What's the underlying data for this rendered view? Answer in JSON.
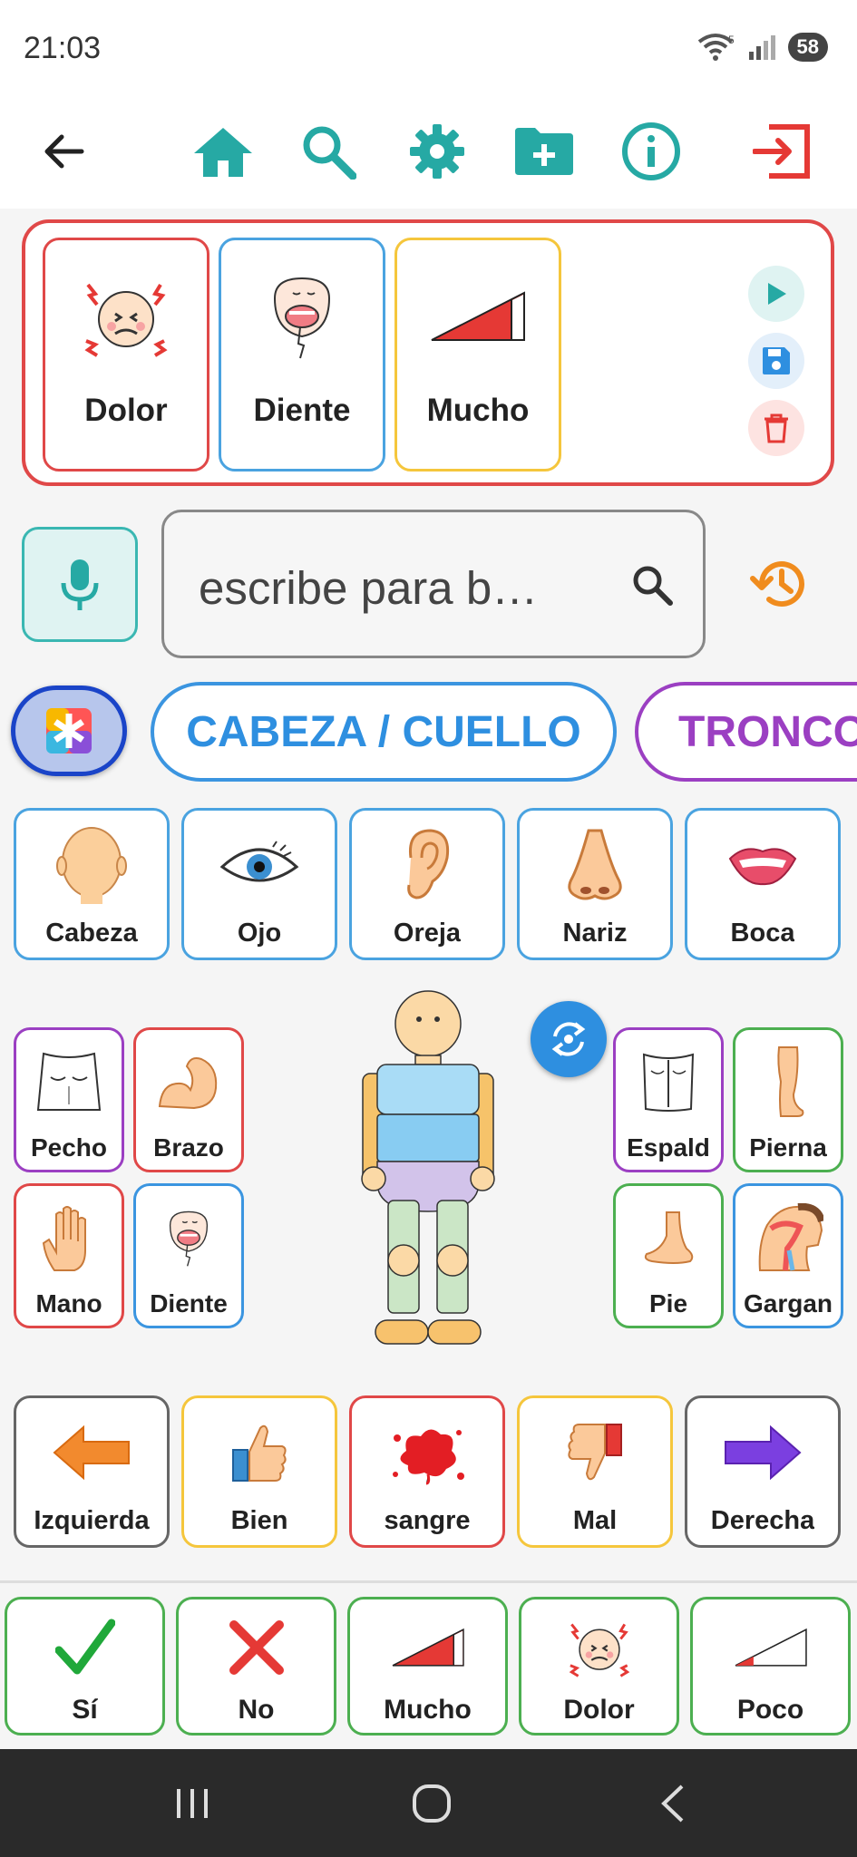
{
  "status": {
    "time": "21:03",
    "battery": "58",
    "wifi_badge": "5"
  },
  "toolbar": {
    "icons": [
      "back-arrow-icon",
      "home-icon",
      "search-icon",
      "settings-gear-icon",
      "folder-add-icon",
      "info-icon",
      "exit-icon"
    ],
    "accent": "#26a9a4",
    "exit_color": "#e53935"
  },
  "sentence": {
    "items": [
      {
        "label": "Dolor",
        "icon": "pain-face-icon",
        "border": "#e04848"
      },
      {
        "label": "Diente",
        "icon": "tooth-face-icon",
        "border": "#4aa3e0"
      },
      {
        "label": "Mucho",
        "icon": "much-ramp-icon",
        "border": "#f5c63c"
      }
    ],
    "actions": [
      "play-icon",
      "save-icon",
      "trash-icon"
    ]
  },
  "search": {
    "placeholder": "escribe para b…"
  },
  "categories": [
    {
      "label": "",
      "icon": "medical-star-icon",
      "border": "#1a44c8"
    },
    {
      "label": "CABEZA / CUELLO",
      "border": "#3b95e0",
      "color": "#2e8fe0"
    },
    {
      "label": "TRONCO",
      "border": "#9b3fc2",
      "color": "#9b3fc2"
    }
  ],
  "head_items": [
    {
      "label": "Cabeza",
      "icon": "head-icon"
    },
    {
      "label": "Ojo",
      "icon": "eye-icon"
    },
    {
      "label": "Oreja",
      "icon": "ear-icon"
    },
    {
      "label": "Nariz",
      "icon": "nose-icon"
    },
    {
      "label": "Boca",
      "icon": "mouth-icon"
    }
  ],
  "body_left": [
    {
      "label": "Pecho",
      "icon": "chest-icon",
      "border": "#9b3fc2"
    },
    {
      "label": "Brazo",
      "icon": "arm-icon",
      "border": "#e04848"
    },
    {
      "label": "Mano",
      "icon": "hand-icon",
      "border": "#e04848"
    },
    {
      "label": "Diente",
      "icon": "tooth-face-icon",
      "border": "#3b95e0"
    }
  ],
  "body_right": [
    {
      "label": "Espald",
      "icon": "back-icon",
      "border": "#9b3fc2"
    },
    {
      "label": "Pierna",
      "icon": "leg-icon",
      "border": "#4caf50"
    },
    {
      "label": "Pie",
      "icon": "foot-icon",
      "border": "#4caf50"
    },
    {
      "label": "Gargan",
      "icon": "throat-icon",
      "border": "#3b95e0"
    }
  ],
  "descriptors": [
    {
      "label": "Izquierda",
      "icon": "left-arrow-icon",
      "border": "#666666"
    },
    {
      "label": "Bien",
      "icon": "thumbs-up-icon",
      "border": "#f5c63c"
    },
    {
      "label": "sangre",
      "icon": "blood-icon",
      "border": "#e04848"
    },
    {
      "label": "Mal",
      "icon": "thumbs-down-icon",
      "border": "#f5c63c"
    },
    {
      "label": "Derecha",
      "icon": "right-arrow-icon",
      "border": "#666666"
    }
  ],
  "quick": [
    {
      "label": "Sí",
      "icon": "check-icon"
    },
    {
      "label": "No",
      "icon": "cross-icon"
    },
    {
      "label": "Mucho",
      "icon": "much-ramp-icon"
    },
    {
      "label": "Dolor",
      "icon": "pain-face-icon"
    },
    {
      "label": "Poco",
      "icon": "little-ramp-icon"
    }
  ],
  "quick_border": "#4caf50"
}
